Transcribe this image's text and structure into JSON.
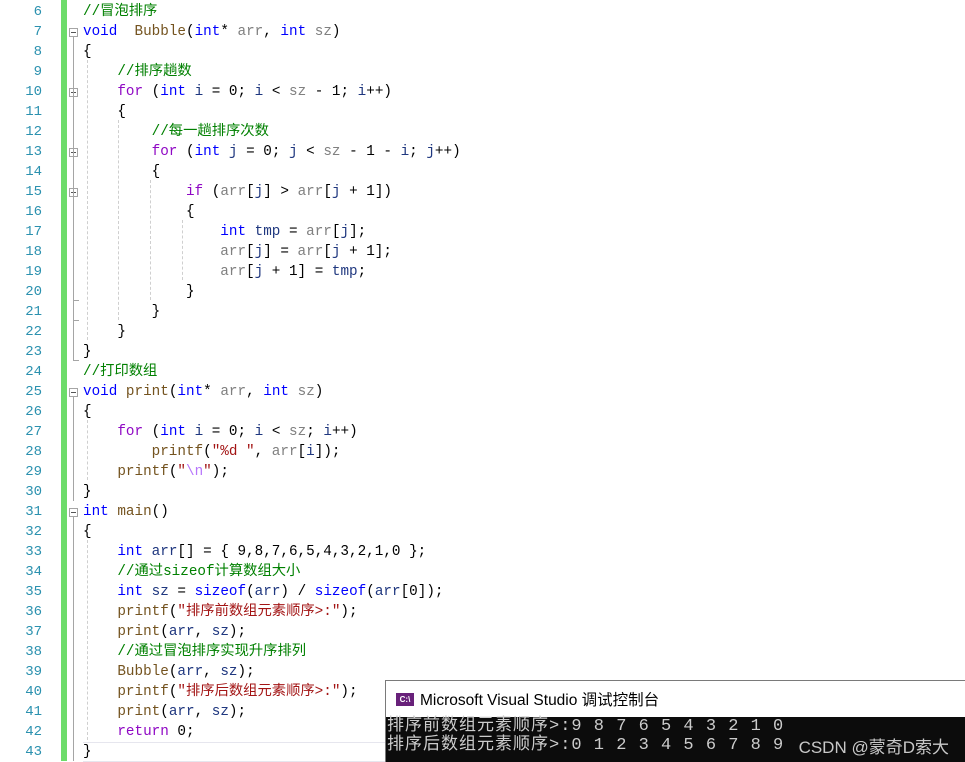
{
  "editor": {
    "line_numbers": [
      "6",
      "7",
      "8",
      "9",
      "10",
      "11",
      "12",
      "13",
      "14",
      "15",
      "16",
      "17",
      "18",
      "19",
      "20",
      "21",
      "22",
      "23",
      "24",
      "25",
      "26",
      "27",
      "28",
      "29",
      "30",
      "31",
      "32",
      "33",
      "34",
      "35",
      "36",
      "37",
      "38",
      "39",
      "40",
      "41",
      "42",
      "43"
    ],
    "lines": [
      [
        [
          "cmt",
          "//冒泡排序"
        ]
      ],
      [
        [
          "kw",
          "void"
        ],
        [
          "",
          "  "
        ],
        [
          "fn",
          "Bubble"
        ],
        [
          "",
          "("
        ],
        [
          "kw",
          "int"
        ],
        [
          "",
          "* "
        ],
        [
          "prm",
          "arr"
        ],
        [
          "",
          ", "
        ],
        [
          "kw",
          "int"
        ],
        [
          "",
          ""
        ],
        [
          "prm",
          " sz"
        ],
        [
          "",
          ")"
        ]
      ],
      [
        [
          "",
          "{"
        ]
      ],
      [
        [
          "",
          "    "
        ],
        [
          "cmt",
          "//排序趟数"
        ]
      ],
      [
        [
          "",
          "    "
        ],
        [
          "ctl",
          "for"
        ],
        [
          "",
          " ("
        ],
        [
          "kw",
          "int"
        ],
        [
          "",
          " "
        ],
        [
          "var",
          "i"
        ],
        [
          "",
          " = 0; "
        ],
        [
          "var",
          "i"
        ],
        [
          "",
          " < "
        ],
        [
          "prm",
          "sz"
        ],
        [
          "",
          " - 1; "
        ],
        [
          "var",
          "i"
        ],
        [
          "",
          "++)"
        ]
      ],
      [
        [
          "",
          "    {"
        ]
      ],
      [
        [
          "",
          "        "
        ],
        [
          "cmt",
          "//每一趟排序次数"
        ]
      ],
      [
        [
          "",
          "        "
        ],
        [
          "ctl",
          "for"
        ],
        [
          "",
          " ("
        ],
        [
          "kw",
          "int"
        ],
        [
          "",
          " "
        ],
        [
          "var",
          "j"
        ],
        [
          "",
          " = 0; "
        ],
        [
          "var",
          "j"
        ],
        [
          "",
          " < "
        ],
        [
          "prm",
          "sz"
        ],
        [
          "",
          " - 1 - "
        ],
        [
          "var",
          "i"
        ],
        [
          "",
          "; "
        ],
        [
          "var",
          "j"
        ],
        [
          "",
          "++)"
        ]
      ],
      [
        [
          "",
          "        {"
        ]
      ],
      [
        [
          "",
          "            "
        ],
        [
          "ctl",
          "if"
        ],
        [
          "",
          " ("
        ],
        [
          "prm",
          "arr"
        ],
        [
          "",
          "["
        ],
        [
          "var",
          "j"
        ],
        [
          "",
          "] > "
        ],
        [
          "prm",
          "arr"
        ],
        [
          "",
          "["
        ],
        [
          "var",
          "j"
        ],
        [
          "",
          " + 1])"
        ]
      ],
      [
        [
          "",
          "            {"
        ]
      ],
      [
        [
          "",
          "                "
        ],
        [
          "kw",
          "int"
        ],
        [
          "",
          " "
        ],
        [
          "var",
          "tmp"
        ],
        [
          "",
          " = "
        ],
        [
          "prm",
          "arr"
        ],
        [
          "",
          "["
        ],
        [
          "var",
          "j"
        ],
        [
          "",
          "];"
        ]
      ],
      [
        [
          "",
          "                "
        ],
        [
          "prm",
          "arr"
        ],
        [
          "",
          "["
        ],
        [
          "var",
          "j"
        ],
        [
          "",
          "] = "
        ],
        [
          "prm",
          "arr"
        ],
        [
          "",
          "["
        ],
        [
          "var",
          "j"
        ],
        [
          "",
          " + 1];"
        ]
      ],
      [
        [
          "",
          "                "
        ],
        [
          "prm",
          "arr"
        ],
        [
          "",
          "["
        ],
        [
          "var",
          "j"
        ],
        [
          "",
          " + 1] = "
        ],
        [
          "var",
          "tmp"
        ],
        [
          "",
          ";"
        ]
      ],
      [
        [
          "",
          "            }"
        ]
      ],
      [
        [
          "",
          "        }"
        ]
      ],
      [
        [
          "",
          "    }"
        ]
      ],
      [
        [
          "",
          "}"
        ]
      ],
      [
        [
          "cmt",
          "//打印数组"
        ]
      ],
      [
        [
          "kw",
          "void"
        ],
        [
          "",
          " "
        ],
        [
          "fn",
          "print"
        ],
        [
          "",
          "("
        ],
        [
          "kw",
          "int"
        ],
        [
          "",
          "* "
        ],
        [
          "prm",
          "arr"
        ],
        [
          "",
          ", "
        ],
        [
          "kw",
          "int"
        ],
        [
          "",
          " "
        ],
        [
          "prm",
          "sz"
        ],
        [
          "",
          ")"
        ]
      ],
      [
        [
          "",
          "{"
        ]
      ],
      [
        [
          "",
          "    "
        ],
        [
          "ctl",
          "for"
        ],
        [
          "",
          " ("
        ],
        [
          "kw",
          "int"
        ],
        [
          "",
          " "
        ],
        [
          "var",
          "i"
        ],
        [
          "",
          " = 0; "
        ],
        [
          "var",
          "i"
        ],
        [
          "",
          " < "
        ],
        [
          "prm",
          "sz"
        ],
        [
          "",
          "; "
        ],
        [
          "var",
          "i"
        ],
        [
          "",
          "++)"
        ]
      ],
      [
        [
          "",
          "        "
        ],
        [
          "fn",
          "printf"
        ],
        [
          "",
          "("
        ],
        [
          "str",
          "\"%d \""
        ],
        [
          "",
          ", "
        ],
        [
          "prm",
          "arr"
        ],
        [
          "",
          "["
        ],
        [
          "var",
          "i"
        ],
        [
          "",
          "]);"
        ]
      ],
      [
        [
          "",
          "    "
        ],
        [
          "fn",
          "printf"
        ],
        [
          "",
          "("
        ],
        [
          "str",
          "\""
        ],
        [
          "esc",
          "\\n"
        ],
        [
          "str",
          "\""
        ],
        [
          "",
          ");"
        ]
      ],
      [
        [
          "",
          "}"
        ]
      ],
      [
        [
          "kw",
          "int"
        ],
        [
          "",
          " "
        ],
        [
          "fn",
          "main"
        ],
        [
          "",
          "()"
        ]
      ],
      [
        [
          "",
          "{"
        ]
      ],
      [
        [
          "",
          "    "
        ],
        [
          "kw",
          "int"
        ],
        [
          "",
          " "
        ],
        [
          "var",
          "arr"
        ],
        [
          "",
          "[] = { 9,8,7,6,5,4,3,2,1,0 };"
        ]
      ],
      [
        [
          "",
          "    "
        ],
        [
          "cmt",
          "//通过sizeof计算数组大小"
        ]
      ],
      [
        [
          "",
          "    "
        ],
        [
          "kw",
          "int"
        ],
        [
          "",
          " "
        ],
        [
          "var",
          "sz"
        ],
        [
          "",
          " = "
        ],
        [
          "kw",
          "sizeof"
        ],
        [
          "",
          "("
        ],
        [
          "var",
          "arr"
        ],
        [
          "",
          ") / "
        ],
        [
          "kw",
          "sizeof"
        ],
        [
          "",
          "("
        ],
        [
          "var",
          "arr"
        ],
        [
          "",
          "[0]);"
        ]
      ],
      [
        [
          "",
          "    "
        ],
        [
          "fn",
          "printf"
        ],
        [
          "",
          "("
        ],
        [
          "str",
          "\"排序前数组元素顺序>:\""
        ],
        [
          "",
          ");"
        ]
      ],
      [
        [
          "",
          "    "
        ],
        [
          "fn",
          "print"
        ],
        [
          "",
          "("
        ],
        [
          "var",
          "arr"
        ],
        [
          "",
          ", "
        ],
        [
          "var",
          "sz"
        ],
        [
          "",
          ");"
        ]
      ],
      [
        [
          "",
          "    "
        ],
        [
          "cmt",
          "//通过冒泡排序实现升序排列"
        ]
      ],
      [
        [
          "",
          "    "
        ],
        [
          "fn",
          "Bubble"
        ],
        [
          "",
          "("
        ],
        [
          "var",
          "arr"
        ],
        [
          "",
          ", "
        ],
        [
          "var",
          "sz"
        ],
        [
          "",
          ");"
        ]
      ],
      [
        [
          "",
          "    "
        ],
        [
          "fn",
          "printf"
        ],
        [
          "",
          "("
        ],
        [
          "str",
          "\"排序后数组元素顺序>:\""
        ],
        [
          "",
          ");"
        ]
      ],
      [
        [
          "",
          "    "
        ],
        [
          "fn",
          "print"
        ],
        [
          "",
          "("
        ],
        [
          "var",
          "arr"
        ],
        [
          "",
          ", "
        ],
        [
          "var",
          "sz"
        ],
        [
          "",
          ");"
        ]
      ],
      [
        [
          "",
          "    "
        ],
        [
          "ctl",
          "return"
        ],
        [
          "",
          " 0;"
        ]
      ],
      [
        [
          "",
          "}"
        ]
      ]
    ]
  },
  "console": {
    "icon": "console-app-icon",
    "icon_text": "C:\\",
    "title": "Microsoft Visual Studio 调试控制台",
    "output": [
      "排序前数组元素顺序>:9 8 7 6 5 4 3 2 1 0",
      "排序后数组元素顺序>:0 1 2 3 4 5 6 7 8 9"
    ]
  },
  "watermark": "CSDN @蒙奇D索大",
  "colors": {
    "keyword": "#0000ff",
    "control": "#8f08c4",
    "function": "#74531f",
    "local": "#1f377f",
    "parameter": "#808080",
    "comment": "#008000",
    "string": "#a31515",
    "line_number": "#2b91af",
    "change_bar": "#6ddc6a",
    "console_bg": "#0c0c0c"
  }
}
